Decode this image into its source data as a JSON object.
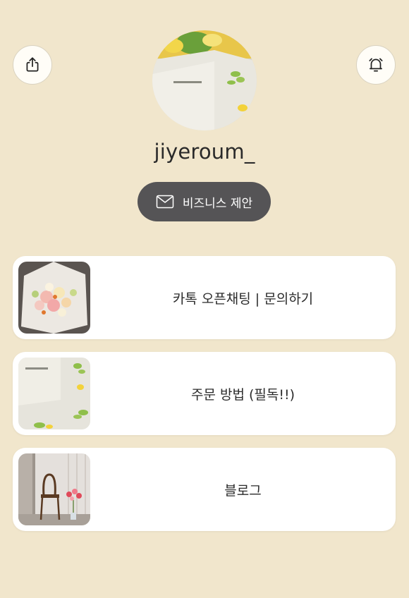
{
  "header": {
    "share_icon": "share-icon",
    "bell_icon": "alarm-bell-icon"
  },
  "profile": {
    "username": "jiyeroum_",
    "avatar": "flower-box-photo"
  },
  "business_button": {
    "label": "비즈니스 제안",
    "icon": "envelope-icon"
  },
  "links": [
    {
      "label": "카톡 오픈채팅 | 문의하기",
      "thumbnail": "bouquet-photo"
    },
    {
      "label": "주문 방법 (필독!!)",
      "thumbnail": "flower-box-photo"
    },
    {
      "label": "블로그",
      "thumbnail": "chair-flowers-photo"
    }
  ],
  "colors": {
    "background": "#f1e6cc",
    "button_dark": "#555456",
    "card": "#ffffff"
  }
}
